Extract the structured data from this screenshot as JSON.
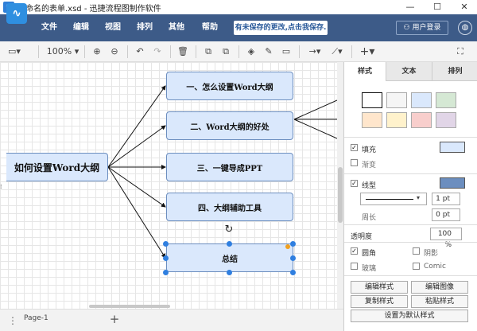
{
  "window": {
    "title": "未命名的表单.xsd - 迅捷流程图制作软件",
    "minimize": "—",
    "maximize": "☐",
    "close": "✕"
  },
  "menubar": {
    "items": [
      "文件",
      "编辑",
      "视图",
      "排列",
      "其他",
      "帮助"
    ],
    "save_notice": "有未保存的更改,点击我保存.",
    "login": "用户登录"
  },
  "toolbar": {
    "zoom": "100%"
  },
  "diagram": {
    "root": "如何设置Word大纲",
    "nodes": [
      "一、怎么设置Word大纲",
      "二、Word大纲的好处",
      "三、一键导成PPT",
      "四、大纲辅助工具",
      "总结"
    ]
  },
  "bottombar": {
    "page_tab": "Page-1",
    "add": "+",
    "menu": "⋮"
  },
  "panel": {
    "tabs": [
      "样式",
      "文本",
      "排列"
    ],
    "fill_label": "填充",
    "gradient_label": "渐变",
    "line_label": "线型",
    "line_width": "1 pt",
    "perimeter_label": "周长",
    "perimeter_value": "0 pt",
    "opacity_label": "透明度",
    "opacity_value": "100 %",
    "rounded_label": "圆角",
    "shadow_label": "阴影",
    "glass_label": "玻璃",
    "comic_label": "Comic",
    "buttons": [
      "编辑样式",
      "编辑图像",
      "复制样式",
      "粘贴样式",
      "设置为默认样式"
    ]
  },
  "colors": {
    "menubar": "#3d5b88",
    "node_fill": "#dae8fc",
    "node_border": "#6c8ebf",
    "handle": "#2f7fe0",
    "swatches": [
      "#ffffff",
      "#f5f5f5",
      "#dae8fc",
      "#d5e8d4",
      "#ffe6cc",
      "#fff2cc",
      "#f8cecc",
      "#e1d5e7"
    ]
  }
}
